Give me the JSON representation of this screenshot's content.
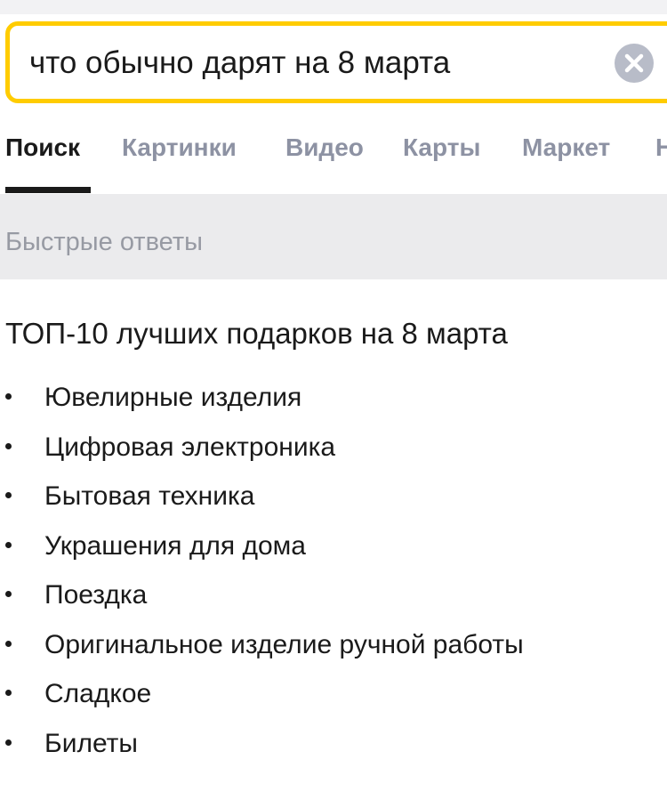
{
  "search": {
    "query": "что обычно дарят на 8 марта"
  },
  "tabs": [
    {
      "label": "Поиск",
      "active": true
    },
    {
      "label": "Картинки",
      "active": false
    },
    {
      "label": "Видео",
      "active": false
    },
    {
      "label": "Карты",
      "active": false
    },
    {
      "label": "Маркет",
      "active": false
    },
    {
      "label": "Н",
      "active": false
    }
  ],
  "quick_answers": {
    "label": "Быстрые ответы"
  },
  "answer": {
    "title": "ТОП-10 лучших подарков на 8 марта",
    "items": [
      "Ювелирные изделия",
      "Цифровая электроника",
      "Бытовая техника",
      "Украшения для дома",
      "Поездка",
      "Оригинальное изделие ручной работы",
      "Сладкое",
      "Билеты"
    ]
  },
  "colors": {
    "search_border": "#ffcc00",
    "tab_inactive": "#8d92a3",
    "band_background": "#ebebed",
    "clear_button": "#b8bcc8"
  },
  "icons": {
    "clear": "close-icon"
  }
}
